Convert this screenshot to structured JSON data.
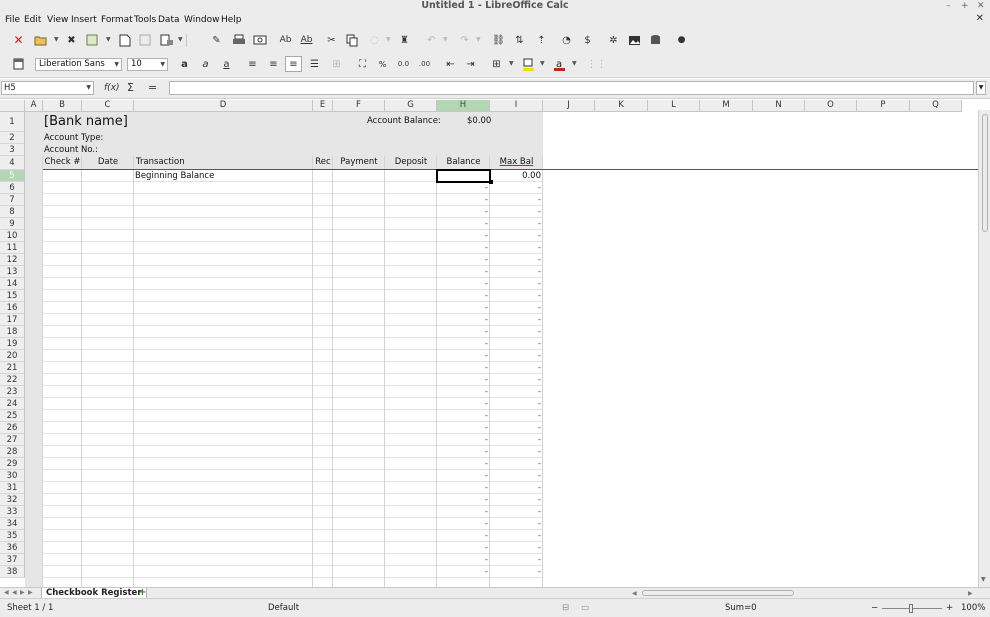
{
  "window": {
    "title": "Untitled 1 - LibreOffice Calc",
    "controls": [
      "minimize-icon",
      "maximize-icon",
      "close-icon"
    ]
  },
  "menu": [
    "File",
    "Edit",
    "View",
    "Insert",
    "Format",
    "Tools",
    "Data",
    "Window",
    "Help"
  ],
  "formatting": {
    "font_name": "Liberation Sans",
    "font_size": "10"
  },
  "formula_bar": {
    "cell_ref": "H5",
    "function_wizard": "f(x)",
    "sum_symbol": "Σ",
    "equals_symbol": "=",
    "content": ""
  },
  "columns": [
    "A",
    "B",
    "C",
    "D",
    "E",
    "F",
    "G",
    "H",
    "I",
    "J",
    "K",
    "L",
    "M",
    "N",
    "O",
    "P",
    "Q"
  ],
  "rows": [
    "1",
    "2",
    "3",
    "4",
    "5",
    "6",
    "7",
    "8",
    "9",
    "10",
    "11",
    "12",
    "13",
    "14",
    "15",
    "16",
    "17",
    "18",
    "19",
    "20",
    "21",
    "22",
    "23",
    "24",
    "25",
    "26",
    "27",
    "28",
    "29",
    "30",
    "31",
    "32",
    "33",
    "34",
    "35",
    "36",
    "37",
    "38"
  ],
  "sheet": {
    "bank_name": "[Bank name]",
    "account_balance_label": "Account Balance:",
    "account_balance_value": "$0.00",
    "account_type_label": "Account Type:",
    "account_no_label": "Account No.:",
    "headers": [
      "Check #",
      "Date",
      "Transaction",
      "Rec",
      "Payment",
      "Deposit",
      "Balance",
      "Max Bal"
    ],
    "row5_transaction": "Beginning Balance",
    "row5_maxbal": "0.00",
    "blank_balance": "-",
    "blank_maxbal": "-"
  },
  "tabs": {
    "sheet_name": "Checkbook Register",
    "add_sheet": "+"
  },
  "status": {
    "sheet_position": "Sheet 1 / 1",
    "page_style": "Default",
    "sum": "Sum=0",
    "zoom_minus": "−",
    "zoom_plus": "+",
    "zoom_level": "100%"
  },
  "colors": {
    "chrome": "#ececec",
    "selected_header": "#b4d6b4",
    "template_shade": "#e6e6e6",
    "font_color_red": "#c0261d",
    "highlight_yellow": "#f2e000"
  }
}
